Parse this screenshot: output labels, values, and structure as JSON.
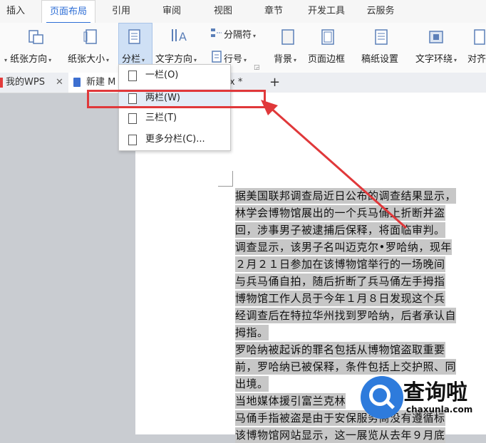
{
  "ribbon_tabs": [
    {
      "label": "插入"
    },
    {
      "label": "页面布局"
    },
    {
      "label": "引用"
    },
    {
      "label": "审阅"
    },
    {
      "label": "视图"
    },
    {
      "label": "章节"
    },
    {
      "label": "开发工具"
    },
    {
      "label": "云服务"
    }
  ],
  "ribbon": {
    "paper_orientation": "纸张方向",
    "paper_size": "纸张大小",
    "columns": "分栏",
    "text_direction": "文字方向",
    "separator": "分隔符",
    "line_number": "行号",
    "background": "背景",
    "page_border": "页面边框",
    "manuscript": "稿纸设置",
    "text_wrap": "文字环绕",
    "align": "对齐"
  },
  "doc_tabs": {
    "wps": "我的WPS",
    "new_doc": "新建 M",
    "doc2_suffix": "x *",
    "add": "+"
  },
  "menu": {
    "items": [
      {
        "label": "一栏(O)"
      },
      {
        "label": "两栏(W)"
      },
      {
        "label": "三栏(T)"
      },
      {
        "label": "更多分栏(C)..."
      }
    ]
  },
  "document": {
    "lines": [
      "据美国联邦调查局近日公布的调查结果显示，",
      "林学会博物馆展出的一个兵马俑上折断并盗",
      "回，涉事男子被逮捕后保释，将面临审判。",
      "调查显示，该男子名叫迈克尔•罗哈纳，现年",
      "２月２１日参加在该博物馆举行的一场晚间",
      "与兵马俑自拍，随后折断了兵马俑左手拇指",
      "博物馆工作人员于今年１月８日发现这个兵",
      "经调查后在特拉华州找到罗哈纳，后者承认自",
      "拇指。",
      "罗哈纳被起诉的罪名包括从博物馆盗取重要",
      "前，罗哈纳已被保释，条件包括上交护照、同",
      "出境。",
      "当地媒体援引富兰克林",
      "马俑手指被盗是由于安保服务商没有遵循标",
      "该博物馆网站显示，这一展览从去年９月底"
    ]
  },
  "watermark": {
    "text": "查询啦",
    "url": "chaxunla.com"
  },
  "colors": {
    "accent": "#2d6ed6",
    "highlight_box": "#e0383a",
    "watermark_blue": "#2e7bdc"
  }
}
